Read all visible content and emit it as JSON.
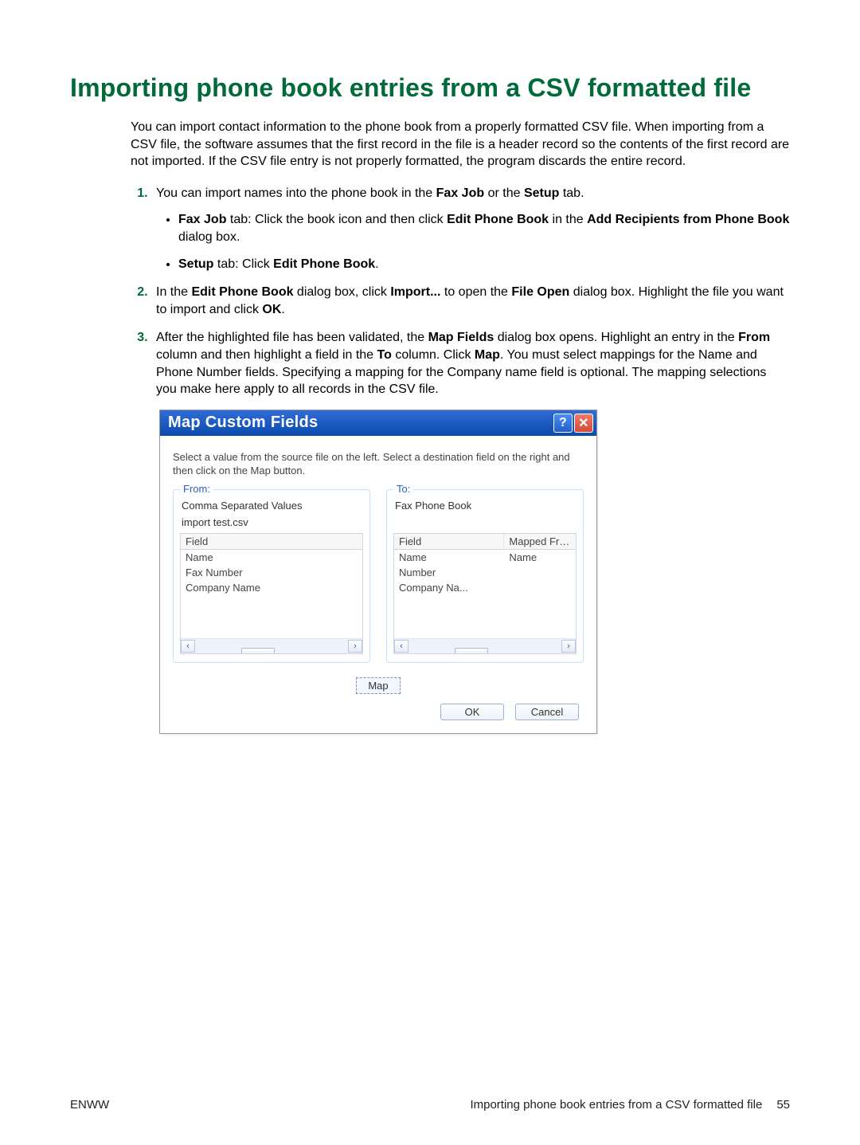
{
  "title": "Importing phone book entries from a CSV formatted file",
  "intro": "You can import contact information to the phone book from a properly formatted CSV file. When importing from a CSV file, the software assumes that the first record in the file is a header record so the contents of the first record are not imported. If the CSV file entry is not properly formatted, the program discards the entire record.",
  "step1_lead": "You can import names into the phone book in the ",
  "step1_bold1": "Fax Job",
  "step1_mid": " or the ",
  "step1_bold2": "Setup",
  "step1_end": " tab.",
  "bullet1_b1": "Fax Job",
  "bullet1_t1": " tab: Click the book icon and then click ",
  "bullet1_b2": "Edit Phone Book",
  "bullet1_t2": " in the ",
  "bullet1_b3": "Add Recipients from Phone Book",
  "bullet1_t3": " dialog box.",
  "bullet2_b1": "Setup",
  "bullet2_t1": " tab: Click ",
  "bullet2_b2": "Edit Phone Book",
  "bullet2_t2": ".",
  "step2_t1": "In the ",
  "step2_b1": "Edit Phone Book",
  "step2_t2": " dialog box, click ",
  "step2_b2": "Import...",
  "step2_t3": " to open the ",
  "step2_b3": "File Open",
  "step2_t4": " dialog box. Highlight the file you want to import and click ",
  "step2_b4": "OK",
  "step2_t5": ".",
  "step3_t1": "After the highlighted file has been validated, the ",
  "step3_b1": "Map Fields",
  "step3_t2": " dialog box opens. Highlight an entry in the ",
  "step3_b2": "From",
  "step3_t3": " column and then highlight a field in the ",
  "step3_b3": "To",
  "step3_t4": " column. Click ",
  "step3_b4": "Map",
  "step3_t5": ". You must select mappings for the Name and Phone Number fields. Specifying a mapping for the Company name field is optional. The mapping selections you make here apply to all records in the CSV file.",
  "dialog": {
    "title": "Map Custom Fields",
    "help": "?",
    "close": "✕",
    "instruction": "Select a value from the source file on the left. Select a destination field on the right and then click on the Map button.",
    "from_legend": "From:",
    "from_source": "Comma Separated Values",
    "from_file": "import test.csv",
    "from_header": "Field",
    "from_rows": [
      "Name",
      "Fax Number",
      "Company Name"
    ],
    "to_legend": "To:",
    "to_source": "Fax Phone Book",
    "to_header_field": "Field",
    "to_header_mapped": "Mapped From",
    "to_rows": [
      {
        "field": "Name",
        "mapped": "Name"
      },
      {
        "field": "Number",
        "mapped": ""
      },
      {
        "field": "Company Na...",
        "mapped": ""
      }
    ],
    "map_btn": "Map",
    "ok_btn": "OK",
    "cancel_btn": "Cancel"
  },
  "footer": {
    "left": "ENWW",
    "right": "Importing phone book entries from a CSV formatted file",
    "page": "55"
  }
}
